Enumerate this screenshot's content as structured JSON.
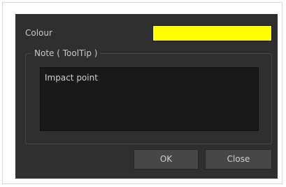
{
  "dialog": {
    "colour_label": "Colour",
    "colour_value": "#ffff00",
    "note_legend": "Note ( ToolTip )",
    "note_text": "Impact point",
    "ok_label": "OK",
    "close_label": "Close"
  }
}
